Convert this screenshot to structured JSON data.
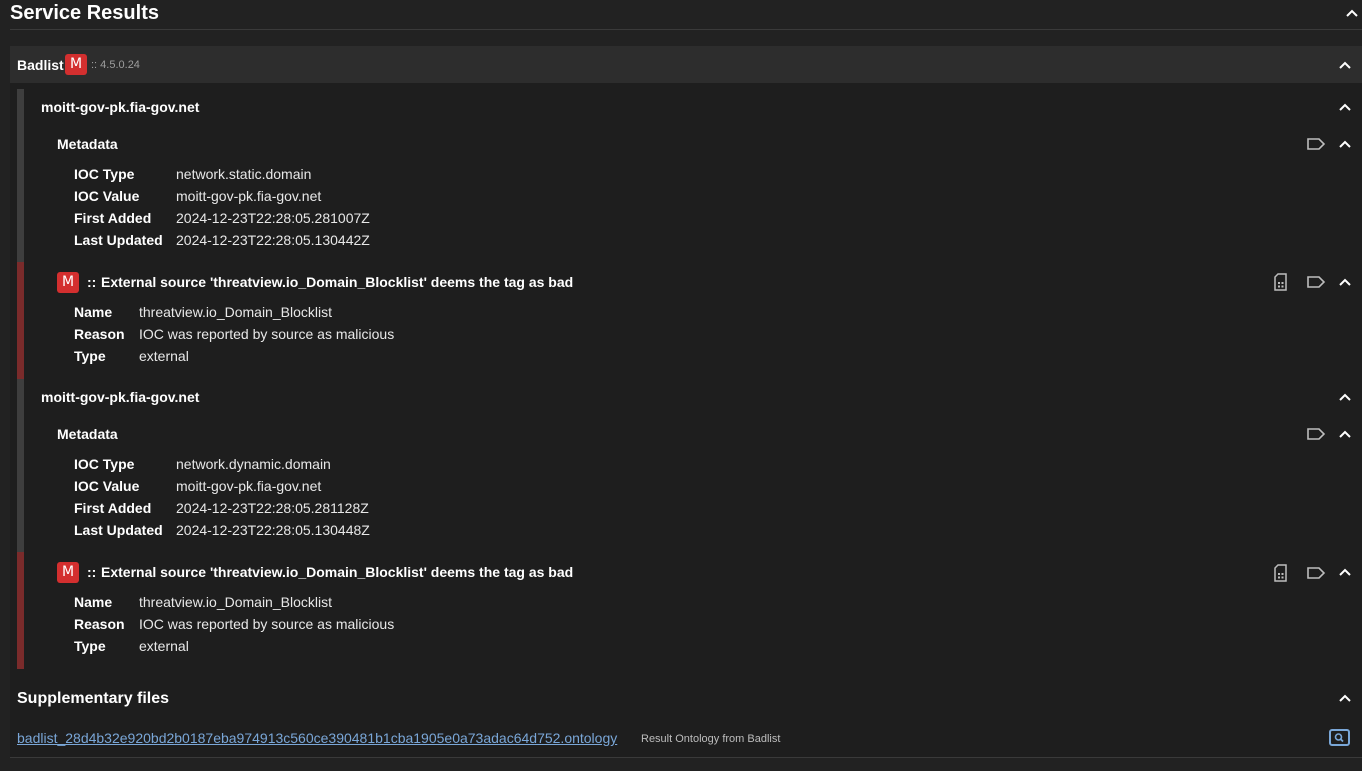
{
  "page": {
    "title": "Service Results"
  },
  "service": {
    "name": "Badlist",
    "badge": "M",
    "version": ":: 4.5.0.24",
    "colors": {
      "malicious": "#d32f2f",
      "bar_malicious": "#7a2b2b",
      "bar_neutral": "#3e3e3e",
      "link": "#7aa7d8"
    }
  },
  "results": [
    {
      "title": "moitt-gov-pk.fia-gov.net",
      "metadata_label": "Metadata",
      "metadata": [
        {
          "key": "IOC Type",
          "value": "network.static.domain"
        },
        {
          "key": "IOC Value",
          "value": "moitt-gov-pk.fia-gov.net"
        },
        {
          "key": "First Added",
          "value": "2024-12-23T22:28:05.281007Z"
        },
        {
          "key": "Last Updated",
          "value": "2024-12-23T22:28:05.130442Z"
        }
      ],
      "heuristic": {
        "badge": "M",
        "separator": "::",
        "text": "External source 'threatview.io_Domain_Blocklist' deems the tag as bad",
        "fields": [
          {
            "key": "Name",
            "value": "threatview.io_Domain_Blocklist"
          },
          {
            "key": "Reason",
            "value": "IOC was reported by source as malicious"
          },
          {
            "key": "Type",
            "value": "external"
          }
        ]
      }
    },
    {
      "title": "moitt-gov-pk.fia-gov.net",
      "metadata_label": "Metadata",
      "metadata": [
        {
          "key": "IOC Type",
          "value": "network.dynamic.domain"
        },
        {
          "key": "IOC Value",
          "value": "moitt-gov-pk.fia-gov.net"
        },
        {
          "key": "First Added",
          "value": "2024-12-23T22:28:05.281128Z"
        },
        {
          "key": "Last Updated",
          "value": "2024-12-23T22:28:05.130448Z"
        }
      ],
      "heuristic": {
        "badge": "M",
        "separator": "::",
        "text": "External source 'threatview.io_Domain_Blocklist' deems the tag as bad",
        "fields": [
          {
            "key": "Name",
            "value": "threatview.io_Domain_Blocklist"
          },
          {
            "key": "Reason",
            "value": "IOC was reported by source as malicious"
          },
          {
            "key": "Type",
            "value": "external"
          }
        ]
      }
    }
  ],
  "supplementary": {
    "title": "Supplementary files",
    "file_name": "badlist_28d4b32e920bd2b0187eba974913c560ce390481b1cba1905e0a73adac64d752.ontology",
    "file_desc": "Result Ontology from Badlist"
  },
  "icons": {
    "collapse": "chevron-up-icon",
    "tag": "tag-icon",
    "sim_card": "sim-card-icon",
    "search": "search-icon"
  }
}
